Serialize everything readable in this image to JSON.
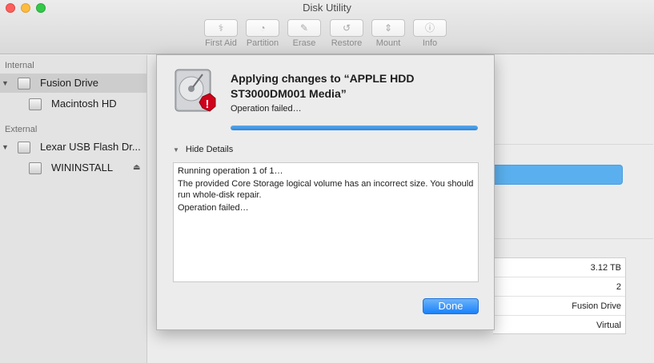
{
  "window": {
    "title": "Disk Utility"
  },
  "toolbar": {
    "items": [
      {
        "label": "First Aid",
        "icon": "first-aid-icon",
        "glyph": "⚕"
      },
      {
        "label": "Partition",
        "icon": "partition-icon",
        "glyph": "◔"
      },
      {
        "label": "Erase",
        "icon": "erase-icon",
        "glyph": "✎"
      },
      {
        "label": "Restore",
        "icon": "restore-icon",
        "glyph": "↺"
      },
      {
        "label": "Mount",
        "icon": "mount-icon",
        "glyph": "⇕"
      },
      {
        "label": "Info",
        "icon": "info-icon",
        "glyph": "ⓘ"
      }
    ]
  },
  "sidebar": {
    "internal_label": "Internal",
    "external_label": "External",
    "items": [
      {
        "label": "Fusion Drive"
      },
      {
        "label": "Macintosh HD"
      },
      {
        "label": "Lexar USB Flash Dr..."
      },
      {
        "label": "WININSTALL"
      }
    ]
  },
  "info_table": {
    "values": [
      "3.12 TB",
      "2",
      "Fusion Drive",
      "Virtual"
    ]
  },
  "dialog": {
    "title": "Applying changes to “APPLE HDD ST3000DM001 Media”",
    "status": "Operation failed…",
    "progress": 1.0,
    "details_toggle": "Hide Details",
    "log": [
      "Running operation 1 of 1…",
      "The provided Core Storage logical volume has an incorrect size. You should run whole-disk repair.",
      "Operation failed…"
    ],
    "done_label": "Done"
  },
  "colors": {
    "accent": "#2f88d9",
    "error": "#d0021b"
  }
}
